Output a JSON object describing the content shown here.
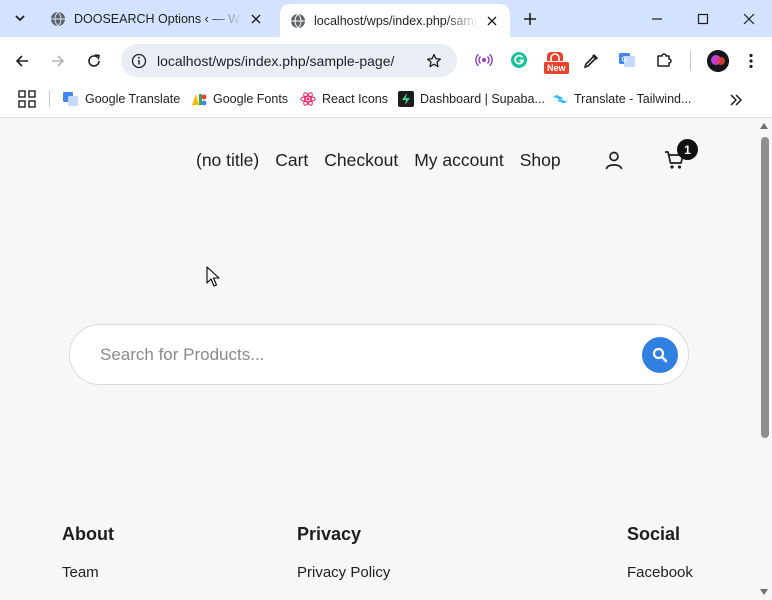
{
  "browser": {
    "tabs": [
      {
        "title": "DOOSEARCH Options ‹ — WordPress",
        "active": false,
        "icon": "globe-icon"
      },
      {
        "title": "localhost/wps/index.php/sample-page/",
        "active": true,
        "icon": "globe-icon"
      }
    ],
    "url": "localhost/wps/index.php/sample-page/",
    "extension_badge": "New",
    "bookmarks": [
      {
        "label": "Google Translate",
        "icon": "google-translate-icon"
      },
      {
        "label": "Google Fonts",
        "icon": "google-fonts-icon"
      },
      {
        "label": "React Icons",
        "icon": "react-icon"
      },
      {
        "label": "Dashboard | Supaba...",
        "icon": "supabase-icon"
      },
      {
        "label": "Translate - Tailwind...",
        "icon": "tailwind-icon"
      }
    ]
  },
  "site": {
    "nav": [
      "(no title)",
      "Cart",
      "Checkout",
      "My account",
      "Shop"
    ],
    "cart_count": "1",
    "search": {
      "placeholder": "Search for Products..."
    },
    "footer": {
      "about": {
        "heading": "About",
        "link": "Team"
      },
      "privacy": {
        "heading": "Privacy",
        "link": "Privacy Policy"
      },
      "social": {
        "heading": "Social",
        "link": "Facebook"
      }
    }
  },
  "colors": {
    "tabstrip": "#d3e3fd",
    "search_button": "#2f80e0",
    "page_background": "#f7f7f7",
    "cart_badge": "#111111"
  }
}
